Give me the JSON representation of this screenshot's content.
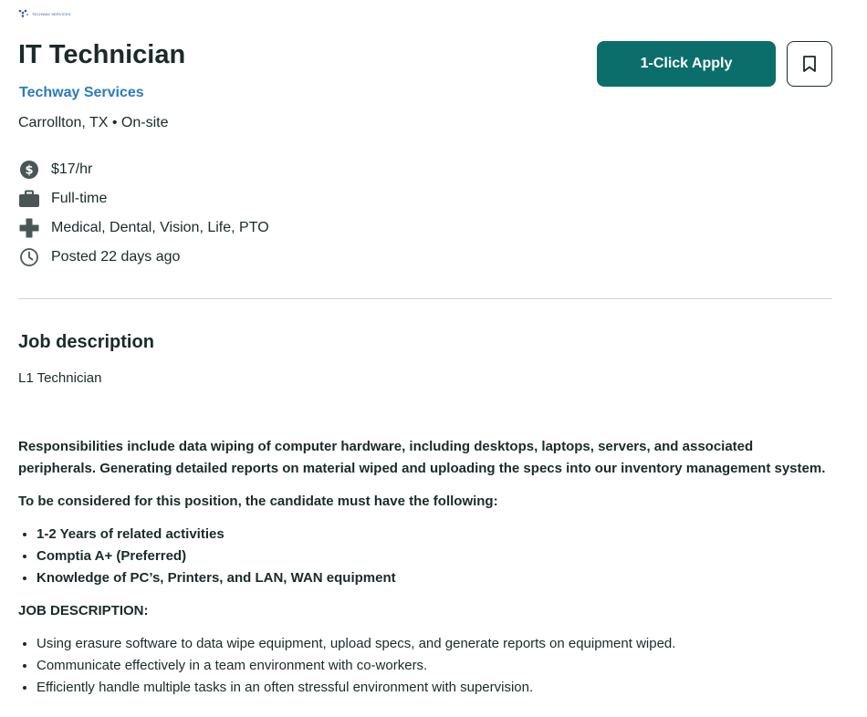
{
  "logo": {
    "text": "TECHWAY SERVICES"
  },
  "job": {
    "title": "IT Technician",
    "company": "Techway Services",
    "location": "Carrollton, TX • On-site"
  },
  "actions": {
    "apply_label": "1-Click Apply",
    "save_icon": "bookmark-icon"
  },
  "meta": {
    "pay": {
      "icon": "dollar-circle-icon",
      "text": "$17/hr"
    },
    "type": {
      "icon": "briefcase-icon",
      "text": "Full-time"
    },
    "benefits": {
      "icon": "medical-cross-icon",
      "text": "Medical, Dental, Vision, Life, PTO"
    },
    "posted": {
      "icon": "clock-icon",
      "text": "Posted 22 days ago"
    }
  },
  "description": {
    "heading": "Job description",
    "intro": "L1 Technician",
    "responsibilities": "Responsibilities include data wiping of computer hardware, including desktops, laptops, servers, and associated peripherals. Generating detailed reports on material wiped and uploading the specs into our inventory management system.",
    "requirements_heading": "To be considered for this position, the candidate must have the following:",
    "requirements": [
      "1-2 Years of related activities",
      "Comptia A+ (Preferred)",
      "Knowledge of PC’s, Printers, and LAN, WAN equipment"
    ],
    "duties_heading": "JOB DESCRIPTION:",
    "duties": [
      "Using erasure software to data wipe equipment, upload specs, and generate reports on equipment wiped.",
      "Communicate effectively in a team environment with co-workers.",
      "Efficiently handle multiple tasks in an often stressful environment with supervision."
    ]
  },
  "colors": {
    "accent": "#0b6e6a",
    "link": "#2a7bbf",
    "text": "#1b2a2a",
    "icon": "#4a5656"
  }
}
